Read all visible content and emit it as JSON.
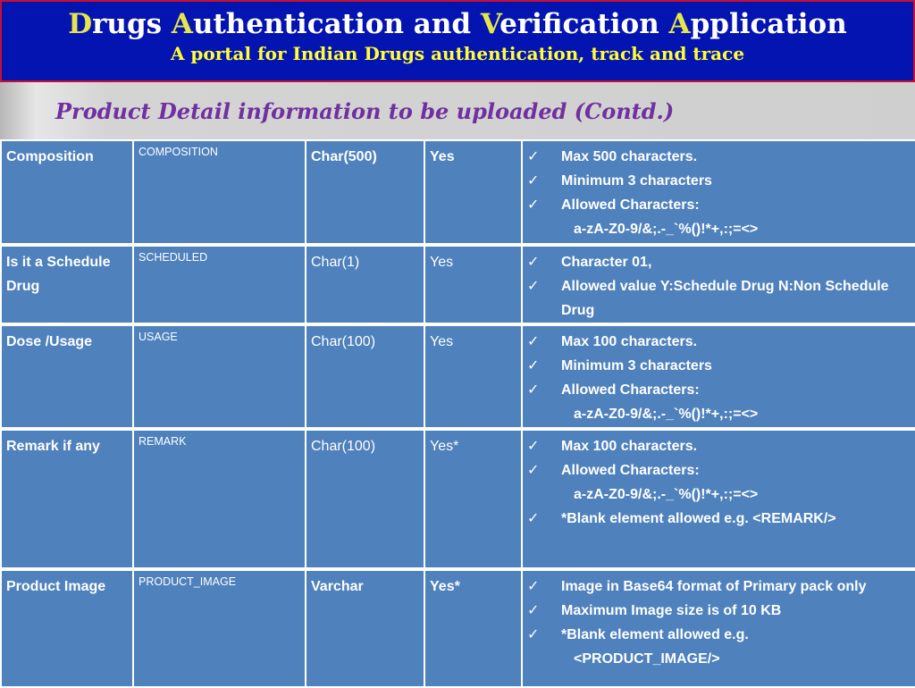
{
  "header": {
    "title_parts": [
      {
        "hl": "D",
        "rest": "rugs "
      },
      {
        "hl": "A",
        "rest": "uthentication and "
      },
      {
        "hl": "V",
        "rest": "erification "
      },
      {
        "hl": "A",
        "rest": "pplication"
      }
    ],
    "subtitle": "A portal for Indian Drugs authentication, track and trace"
  },
  "section": {
    "title": "Product Detail information to be uploaded (Contd.)"
  },
  "colors": {
    "banner_bg": "#0414b0",
    "banner_border": "#c8102e",
    "title_highlight": "#e6e64a",
    "subtitle": "#ffff33",
    "section_title": "#7030a0",
    "cell_bg": "#4f81bd"
  },
  "check_icon": "✓",
  "rows": [
    {
      "name": "Composition",
      "tag": "COMPOSITION",
      "type": "Char(500)",
      "mandatory": "Yes",
      "rules": [
        {
          "text": "Max 500 characters.",
          "check": true
        },
        {
          "text": "Minimum 3 characters",
          "check": true
        },
        {
          "text": "Allowed   Characters:",
          "check": true
        },
        {
          "text": "a-zA-Z0-9/&;.-_`%()!*+,:;=<>",
          "check": false
        }
      ]
    },
    {
      "name": "Is it a Schedule Drug",
      "tag": "SCHEDULED",
      "type": "Char(1)",
      "mandatory": "Yes",
      "rules": [
        {
          "text": "Character 01,",
          "check": true
        },
        {
          "text": "Allowed value Y:Schedule Drug N:Non Schedule Drug",
          "check": true
        }
      ]
    },
    {
      "name": "Dose /Usage",
      "tag": "USAGE",
      "type": "Char(100)",
      "mandatory": "Yes",
      "rules": [
        {
          "text": "Max 100 characters.",
          "check": true
        },
        {
          "text": "Minimum 3 characters",
          "check": true
        },
        {
          "text": "Allowed   Characters:",
          "check": true
        },
        {
          "text": "a-zA-Z0-9/&;.-_`%()!*+,:;=<>",
          "check": false
        }
      ]
    },
    {
      "name": "Remark if any",
      "tag": "REMARK",
      "type": "Char(100)",
      "mandatory": "Yes*",
      "rules": [
        {
          "text": "Max 100 characters.",
          "check": true
        },
        {
          "text": "Allowed   Characters:",
          "check": true
        },
        {
          "text": "a-zA-Z0-9/&;.-_`%()!*+,:;=<>",
          "check": false
        },
        {
          "text": "*Blank element allowed  e.g. <REMARK/>",
          "check": true
        }
      ]
    },
    {
      "name": "Product Image",
      "tag": "PRODUCT_IMAGE",
      "type": "Varchar",
      "mandatory": "Yes*",
      "rules": [
        {
          "text": "Image in Base64 format of Primary pack only",
          "check": true
        },
        {
          "text": "Maximum Image size is of 10 KB",
          "check": true
        },
        {
          "text": "*Blank element allowed  e.g.",
          "check": true
        },
        {
          "text": "<PRODUCT_IMAGE/>",
          "check": false
        }
      ]
    }
  ]
}
